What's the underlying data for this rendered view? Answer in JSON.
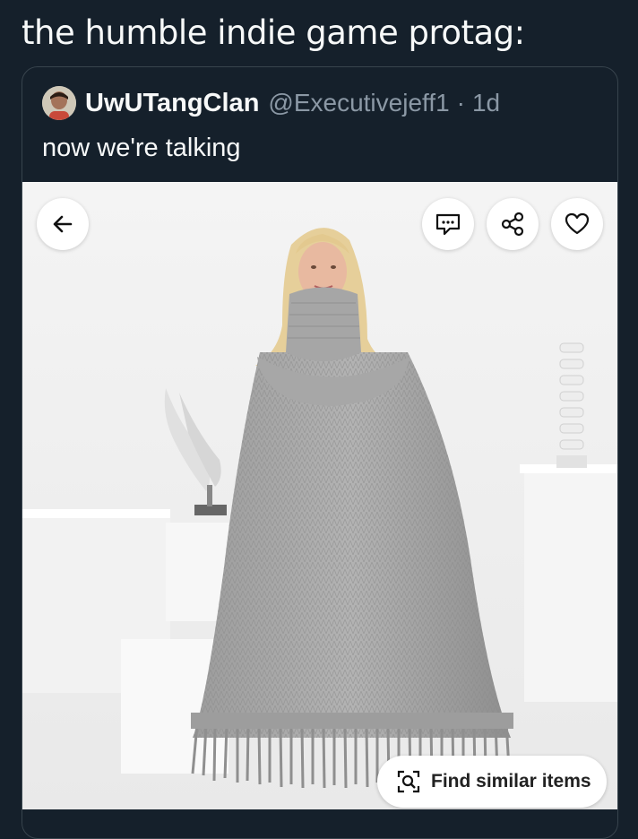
{
  "post": {
    "caption": "the humble indie game protag:"
  },
  "quoted_tweet": {
    "avatar_icon": "user-avatar",
    "display_name": "UwUTangClan",
    "handle": "@Executivejeff1",
    "separator": "·",
    "time": "1d",
    "text": "now we're talking"
  },
  "media": {
    "description_icon": "knit-poncho-photo",
    "buttons": {
      "back_icon": "arrow-left-icon",
      "message_icon": "chat-bubble-icon",
      "share_icon": "share-icon",
      "favorite_icon": "heart-icon",
      "find_icon": "visual-search-icon"
    },
    "find_similar_label": "Find similar items"
  },
  "colors": {
    "background": "#15202b",
    "text_primary": "#f7f9f9",
    "text_secondary": "#8b98a5",
    "border": "#38444d"
  }
}
